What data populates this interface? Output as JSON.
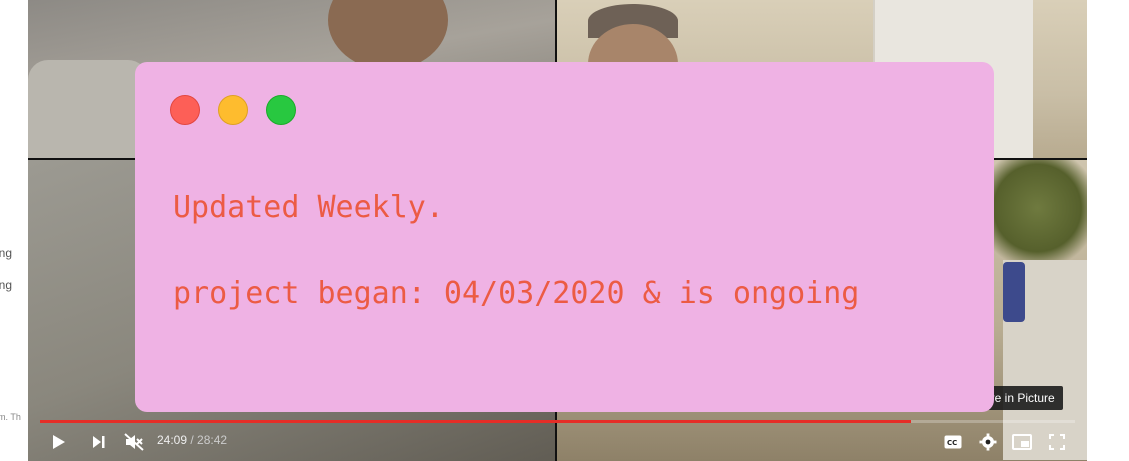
{
  "page_strip": {
    "text_1": "eting",
    "text_2": "eting",
    "text_3": "m. Th"
  },
  "overlay": {
    "line_1": "Updated Weekly.",
    "line_2": "project began: 04/03/2020 & is ongoing",
    "traffic_lights": {
      "close": "#fd5f57",
      "minimize": "#febc2e",
      "zoom": "#28c840"
    }
  },
  "player": {
    "tooltip": "Picture in Picture",
    "tooltip_visible": "ure in Picture",
    "current_time": "24:09",
    "separator": " / ",
    "duration": "28:42",
    "progress_fraction": 0.8416,
    "accent_color": "#e52d27",
    "icons": {
      "play": "play-icon",
      "next": "next-icon",
      "mute": "volume-muted-icon",
      "captions": "captions-icon",
      "settings": "gear-icon",
      "miniplayer": "miniplayer-icon",
      "fullscreen": "fullscreen-icon"
    }
  }
}
